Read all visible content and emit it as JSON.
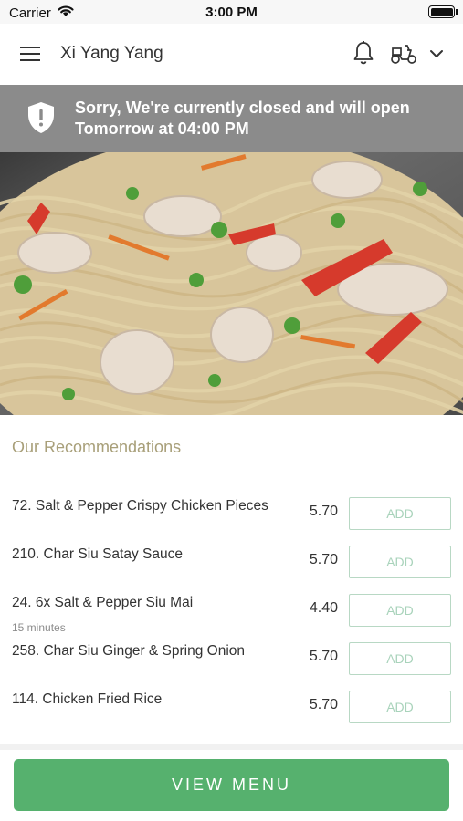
{
  "status_bar": {
    "carrier": "Carrier",
    "time": "3:00 PM"
  },
  "nav": {
    "title": "Xi Yang Yang"
  },
  "banner": {
    "message": "Sorry, We're currently closed and will open Tomorrow at 04:00 PM"
  },
  "recommendations": {
    "title": "Our Recommendations",
    "add_label": "ADD",
    "items": [
      {
        "name": "72. Salt & Pepper Crispy Chicken Pieces",
        "price": "5.70",
        "note": ""
      },
      {
        "name": "210. Char Siu Satay Sauce",
        "price": "5.70",
        "note": ""
      },
      {
        "name": "24. 6x Salt & Pepper Siu Mai",
        "price": "4.40",
        "note": "15 minutes"
      },
      {
        "name": "258. Char Siu Ginger & Spring Onion",
        "price": "5.70",
        "note": ""
      },
      {
        "name": "114. Chicken Fried Rice",
        "price": "5.70",
        "note": ""
      }
    ]
  },
  "footer": {
    "view_menu_label": "VIEW MENU"
  },
  "colors": {
    "accent_green": "#56b16e",
    "banner_gray": "#8b8b8b",
    "section_title": "#a89f79"
  }
}
